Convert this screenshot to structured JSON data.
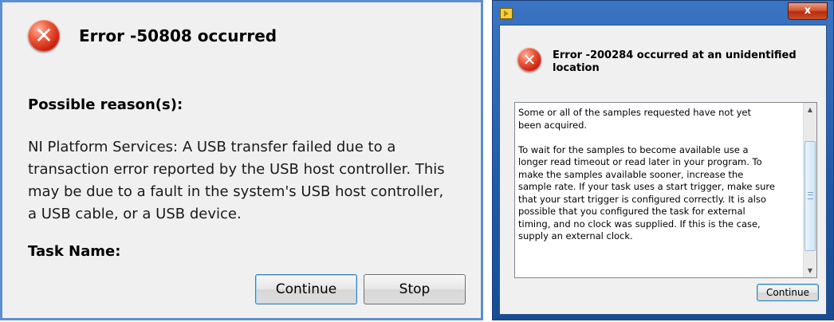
{
  "left_dialog": {
    "title": "Error -50808 occurred",
    "reason_heading": "Possible reason(s):",
    "message_lines": [
      "NI Platform Services:  A USB transfer failed due to a",
      "transaction error reported by the USB host controller.  This",
      "may be due to a fault in the system's USB host controller,",
      "a USB cable, or a USB device."
    ],
    "task_name_label": "Task Name:",
    "buttons": {
      "continue": "Continue",
      "stop": "Stop"
    }
  },
  "right_dialog": {
    "titlebar": {
      "close_glyph": "x"
    },
    "title_lines": [
      "Error -200284 occurred at an unidentified",
      "location"
    ],
    "message_lines": [
      "Some or all of the samples requested have not yet",
      "been acquired.",
      "",
      "To wait for the samples to become available use a",
      "longer read timeout or read later in your program. To",
      "make the samples available sooner, increase the",
      "sample rate. If your task uses a start trigger,  make sure",
      "that your start trigger is configured correctly. It is also",
      "possible that you configured the task for external",
      "timing, and no clock was supplied. If this is the case,",
      "supply an external clock."
    ],
    "buttons": {
      "continue": "Continue"
    }
  },
  "icons": {
    "error": "error-icon",
    "app": "labview-icon",
    "close": "close-icon",
    "scroll_up": "scroll-up-arrow-icon",
    "scroll_down": "scroll-down-arrow-icon"
  },
  "colors": {
    "left_border": "#5c8fd1",
    "dialog_bg": "#f0f0f0",
    "titlebar_blue": "#1e5aa8",
    "close_red": "#c9502a",
    "error_red": "#c21b0c"
  }
}
